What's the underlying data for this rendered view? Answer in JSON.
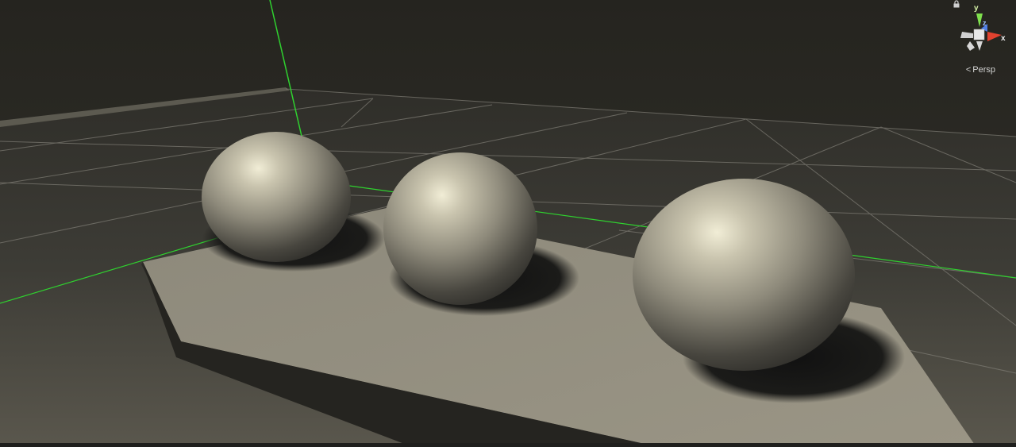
{
  "viewport": {
    "projection_label": "Persp",
    "projection_icon": "chevron-left-icon"
  },
  "gizmo": {
    "axis_y": "y",
    "axis_z": "z",
    "axis_x": "x",
    "lock_icon": "lock-icon"
  },
  "colors": {
    "background": "#2a2a27",
    "floor": "#3c3b36",
    "plinth_top": "#8f8b7c",
    "plinth_front": "#272624",
    "sphere": "#a09c8c",
    "grid_line": "#807e76",
    "axis_green": "#2fd12f",
    "axis_red": "#e0422f",
    "axis_blue": "#4f7fe6"
  },
  "scene": {
    "objects": [
      "plinth",
      "sphere",
      "sphere",
      "sphere"
    ]
  }
}
